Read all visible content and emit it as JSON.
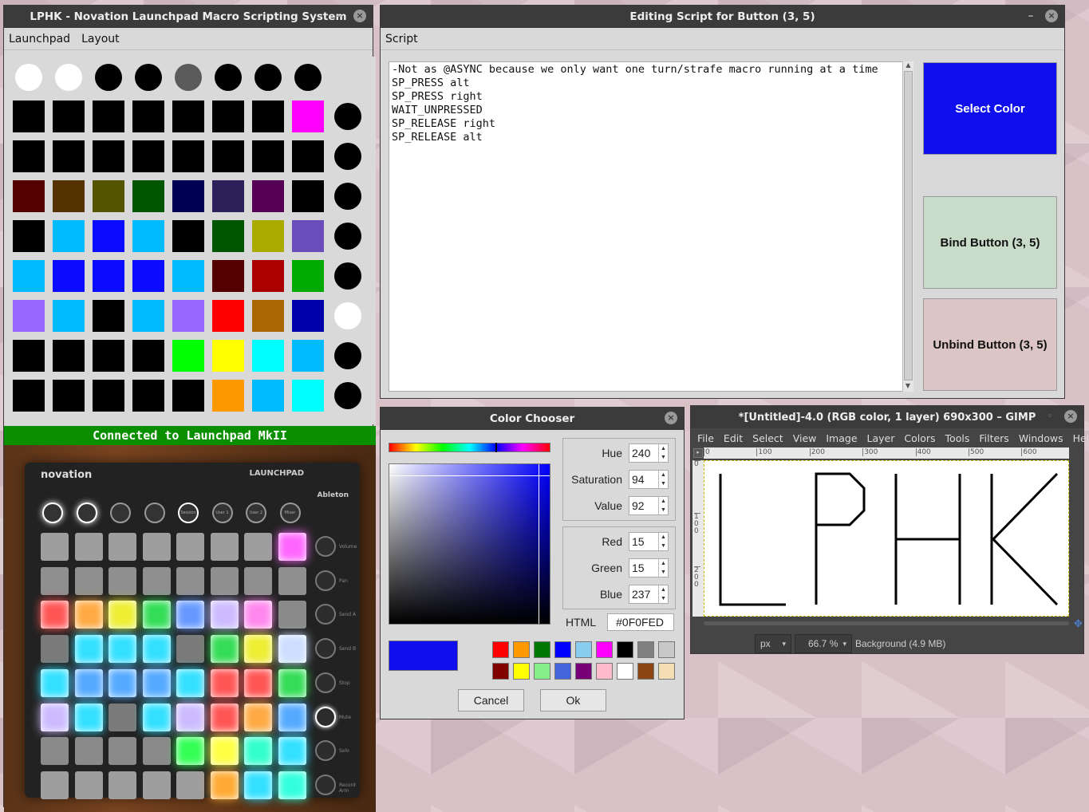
{
  "lphk": {
    "title": "LPHK - Novation Launchpad Macro Scripting System",
    "menu": [
      "Launchpad",
      "Layout"
    ],
    "top_row": [
      "#ffffff",
      "#ffffff",
      "#000000",
      "#000000",
      "#5a5a5a",
      "#000000",
      "#000000",
      "#000000"
    ],
    "grid": [
      [
        "#000000",
        "#000000",
        "#000000",
        "#000000",
        "#000000",
        "#000000",
        "#000000",
        "#ff00ff"
      ],
      [
        "#000000",
        "#000000",
        "#000000",
        "#000000",
        "#000000",
        "#000000",
        "#000000",
        "#000000"
      ],
      [
        "#550000",
        "#553300",
        "#555500",
        "#005500",
        "#000055",
        "#2d1f5a",
        "#550055",
        "#000000"
      ],
      [
        "#000000",
        "#00bbff",
        "#0b0bff",
        "#00bbff",
        "#000000",
        "#005500",
        "#aaaa00",
        "#6a4cbb"
      ],
      [
        "#00bbff",
        "#0b0bff",
        "#0b0bff",
        "#0b0bff",
        "#00bbff",
        "#550000",
        "#aa0000",
        "#00aa00"
      ],
      [
        "#9966ff",
        "#00bbff",
        "#000000",
        "#00bbff",
        "#9966ff",
        "#ff0000",
        "#aa6600",
        "#0000aa"
      ],
      [
        "#000000",
        "#000000",
        "#000000",
        "#000000",
        "#00ff00",
        "#ffff00",
        "#00ffff",
        "#00bbff"
      ],
      [
        "#000000",
        "#000000",
        "#000000",
        "#000000",
        "#000000",
        "#ff9900",
        "#00bbff",
        "#00ffff"
      ]
    ],
    "side_col": [
      "#000000",
      "#000000",
      "#000000",
      "#000000",
      "#000000",
      "#ffffff",
      "#000000",
      "#000000"
    ],
    "status": "Connected to Launchpad MkII",
    "photo": {
      "brand": "novation",
      "model": "LAUNCHPAD",
      "ableton": "Ableton",
      "top_labels": [
        "",
        "",
        "",
        "",
        "Session",
        "User 1",
        "User 2",
        "Mixer"
      ],
      "side_labels": [
        "Volume",
        "Pan",
        "Send A",
        "Send B",
        "Stop",
        "Mute",
        "Solo",
        "Record Arm"
      ],
      "pads": [
        [
          "#9e9e9e",
          "#9e9e9e",
          "#9e9e9e",
          "#9e9e9e",
          "#9e9e9e",
          "#9e9e9e",
          "#9e9e9e",
          "#ff66ff"
        ],
        [
          "#8f8f8f",
          "#8f8f8f",
          "#8f8f8f",
          "#8f8f8f",
          "#8f8f8f",
          "#8f8f8f",
          "#8f8f8f",
          "#8f8f8f"
        ],
        [
          "#ff5555",
          "#ffaa44",
          "#eeee33",
          "#33dd55",
          "#6699ff",
          "#ccbbff",
          "#ff88ee",
          "#8a8a8a"
        ],
        [
          "#7a7a7a",
          "#33e0ff",
          "#33e0ff",
          "#33e0ff",
          "#7a7a7a",
          "#33dd55",
          "#eeee33",
          "#ccddff"
        ],
        [
          "#33e0ff",
          "#55aaff",
          "#55aaff",
          "#55aaff",
          "#33e0ff",
          "#ff5555",
          "#ff5555",
          "#33dd55"
        ],
        [
          "#ccbbff",
          "#33e0ff",
          "#7a7a7a",
          "#33e0ff",
          "#ccbbff",
          "#ff5555",
          "#ffaa44",
          "#55aaff"
        ],
        [
          "#8a8a8a",
          "#8a8a8a",
          "#8a8a8a",
          "#8a8a8a",
          "#33ff55",
          "#ffff44",
          "#33ffcc",
          "#33e0ff"
        ],
        [
          "#9e9e9e",
          "#9e9e9e",
          "#9e9e9e",
          "#9e9e9e",
          "#9e9e9e",
          "#ffaa33",
          "#33e0ff",
          "#33ffdd"
        ]
      ]
    }
  },
  "editor": {
    "title": "Editing Script for Button (3, 5)",
    "menu": [
      "Script"
    ],
    "script": "-Not as @ASYNC because we only want one turn/strafe macro running at a time\nSP_PRESS alt\nSP_PRESS right\nWAIT_UNPRESSED\nSP_RELEASE right\nSP_RELEASE alt",
    "select_color": "Select Color",
    "bind_button": "Bind Button (3, 5)",
    "unbind_button": "Unbind Button (3, 5)",
    "select_color_bg": "#0f0fed",
    "bind_bg": "#c9dcc9",
    "unbind_bg": "#dcc5c5"
  },
  "chooser": {
    "title": "Color Chooser",
    "hue_label": "Hue",
    "hue": "240",
    "sat_label": "Saturation",
    "sat": "94",
    "val_label": "Value",
    "val": "92",
    "red_label": "Red",
    "red": "15",
    "green_label": "Green",
    "green": "15",
    "blue_label": "Blue",
    "blue": "237",
    "html_label": "HTML",
    "html": "#0F0FED",
    "current_color": "#0f0fed",
    "swatches": [
      "#ff0000",
      "#ff9900",
      "#007700",
      "#0000ff",
      "#88ccee",
      "#ff00ff",
      "#000000",
      "#808080",
      "#c8c8c8",
      "#800000",
      "#ffff00",
      "#88ee88",
      "#4466dd",
      "#770077",
      "#ffbbcc",
      "#ffffff",
      "#8b4513",
      "#f5deb3"
    ],
    "cancel": "Cancel",
    "ok": "Ok"
  },
  "gimp": {
    "title": "*[Untitled]-4.0 (RGB color, 1 layer) 690x300 – GIMP",
    "menu": [
      "File",
      "Edit",
      "Select",
      "View",
      "Image",
      "Layer",
      "Colors",
      "Tools",
      "Filters",
      "Windows",
      "Help"
    ],
    "ruler_ticks": [
      "0",
      "100",
      "200",
      "300",
      "400",
      "500",
      "600"
    ],
    "ruler_v_ticks": [
      "0",
      "100",
      "200"
    ],
    "unit": "px",
    "zoom": "66.7 %",
    "layer_info": "Background (4.9 MB)"
  }
}
